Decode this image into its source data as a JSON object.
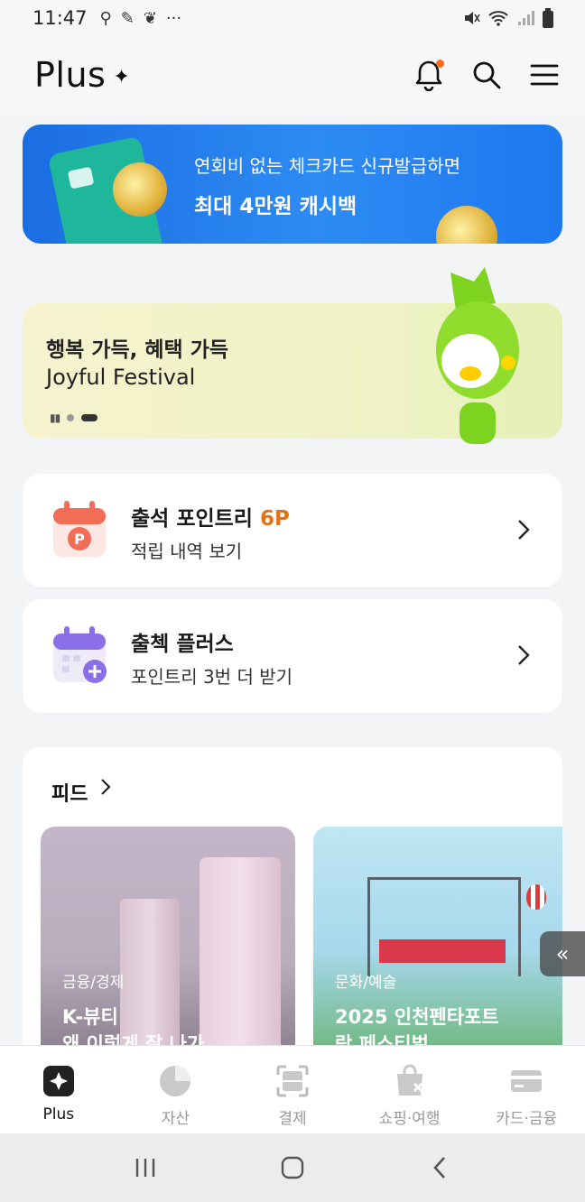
{
  "status_bar": {
    "time": "11:47",
    "more": "···"
  },
  "app_bar": {
    "brand": "Plus",
    "brand_mark": "✦"
  },
  "banner": {
    "line1": "연회비 없는 체크카드 신규발급하면",
    "line2": "최대 4만원 캐시백"
  },
  "festival": {
    "line1": "행복 가득, 혜택 가득",
    "line2": "Joyful Festival"
  },
  "attendance": {
    "title": "출석 포인트리",
    "points": "6P",
    "subtitle": "적립 내역 보기",
    "icon_letter": "P"
  },
  "checkin_plus": {
    "title": "출첵 플러스",
    "subtitle": "포인트리 3번 더 받기"
  },
  "feed": {
    "title": "피드",
    "cards": [
      {
        "category": "금융/경제",
        "headline": "K-뷰티",
        "headline2": "왜 이렇게 잘 나가"
      },
      {
        "category": "문화/예술",
        "headline": "2025 인천펜타포트",
        "headline2": "락 페스티벌"
      }
    ]
  },
  "slide_tab": "«",
  "tabs": [
    {
      "label": "Plus",
      "icon": "sparkle-card-icon",
      "active": true
    },
    {
      "label": "자산",
      "icon": "pie-chart-icon",
      "active": false
    },
    {
      "label": "결제",
      "icon": "scan-icon",
      "active": false
    },
    {
      "label": "쇼핑·여행",
      "icon": "shopping-bag-icon",
      "active": false
    },
    {
      "label": "카드·금융",
      "icon": "credit-card-icon",
      "active": false
    }
  ],
  "colors": {
    "accent": "#e8710f",
    "banner": "#1b6de2",
    "notification_dot": "#ff6a1a"
  }
}
